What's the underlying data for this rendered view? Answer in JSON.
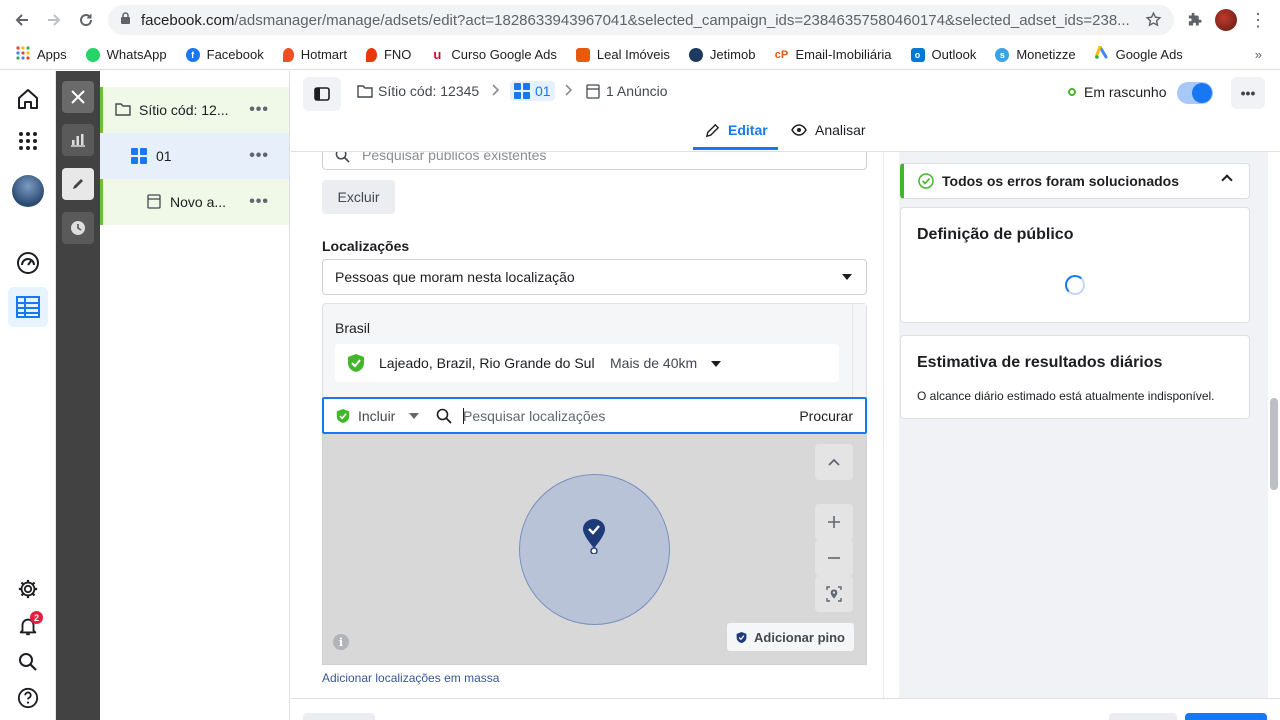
{
  "browser": {
    "url_host": "facebook.com",
    "url_path": "/adsmanager/manage/adsets/edit?act=1828633943967041&selected_campaign_ids=23846357580460174&selected_adset_ids=238..."
  },
  "bookmarks": [
    {
      "label": "Apps",
      "icon": "apps-grid-icon",
      "color": "#ea4335"
    },
    {
      "label": "WhatsApp",
      "icon": "whatsapp-icon",
      "color": "#25d366"
    },
    {
      "label": "Facebook",
      "icon": "facebook-icon",
      "color": "#1877f2"
    },
    {
      "label": "Hotmart",
      "icon": "hotmart-icon",
      "color": "#f04e23"
    },
    {
      "label": "FNO",
      "icon": "fno-icon",
      "color": "#e8380d"
    },
    {
      "label": "Curso Google Ads",
      "icon": "course-icon",
      "color": "#c8102e"
    },
    {
      "label": "Leal Imóveis",
      "icon": "leal-icon",
      "color": "#e8590c"
    },
    {
      "label": "Jetimob",
      "icon": "jetimob-icon",
      "color": "#1e3a5f"
    },
    {
      "label": "Email-Imobiliária",
      "icon": "email-icon",
      "color": "#e8590c"
    },
    {
      "label": "Outlook",
      "icon": "outlook-icon",
      "color": "#0078d4"
    },
    {
      "label": "Monetizze",
      "icon": "monetizze-icon",
      "color": "#3aa3e3"
    },
    {
      "label": "Google Ads",
      "icon": "google-ads-icon",
      "color": "#4285f4"
    }
  ],
  "bookmarks_more": "»",
  "tree": {
    "campaign": "Sítio cód: 12...",
    "adset": "01",
    "ad": "Novo a..."
  },
  "header": {
    "crumb_campaign": "Sítio cód: 12345",
    "crumb_adset": "01",
    "crumb_ad": "1 Anúncio",
    "status": "Em rascunho",
    "tab_edit": "Editar",
    "tab_analyze": "Analisar"
  },
  "main": {
    "search_existing_placeholder": "Pesquisar públicos existentes",
    "exclude_button": "Excluir",
    "locations_label": "Localizações",
    "locations_select": "Pessoas que moram nesta localização",
    "country": "Brasil",
    "location_name": "Lajeado, Brazil, Rio Grande do Sul",
    "location_radius": "Mais de 40km",
    "include_label": "Incluir",
    "search_locations_placeholder": "Pesquisar localizações",
    "search_button": "Procurar",
    "add_pin": "Adicionar pino",
    "bulk_link": "Adicionar localizações em massa"
  },
  "right": {
    "errors_title": "Todos os erros foram solucionados",
    "audience_title": "Definição de público",
    "estimate_title": "Estimativa de resultados diários",
    "estimate_desc": "O alcance diário estimado está atualmente indisponível."
  },
  "notifications_count": "2",
  "colors": {
    "accent": "#1877f2",
    "success": "#42b72a",
    "tool_column": "#424242"
  }
}
